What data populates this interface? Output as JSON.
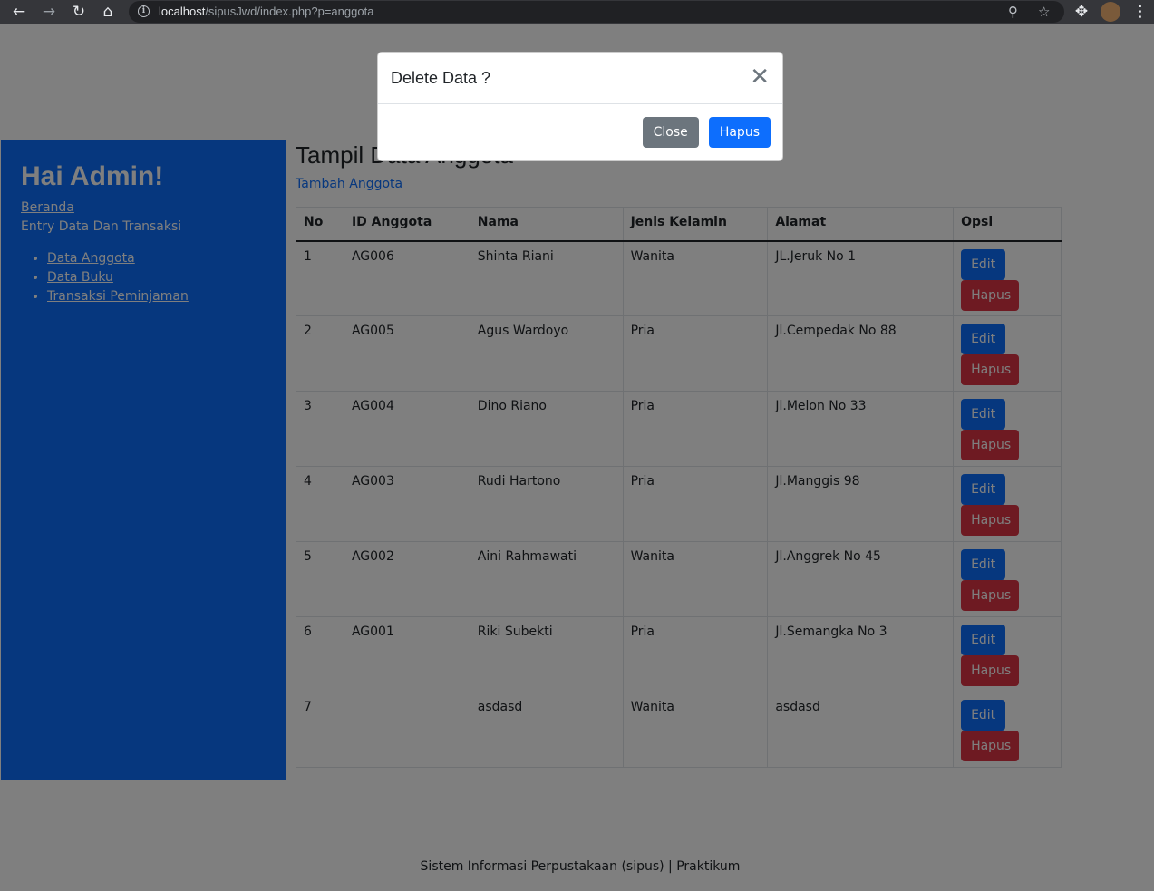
{
  "browser": {
    "url_host": "localhost",
    "url_path": "/sipusJwd/index.php?p=anggota"
  },
  "sidebar": {
    "title": "Hai Admin!",
    "home_link": "Beranda",
    "section_text": "Entry Data Dan Transaksi",
    "menu": [
      {
        "label": "Data Anggota"
      },
      {
        "label": "Data Buku"
      },
      {
        "label": "Transaksi Peminjaman"
      }
    ]
  },
  "main": {
    "title": "Tampil Data Anggota",
    "add_link": "Tambah Anggota",
    "columns": [
      "No",
      "ID Anggota",
      "Nama",
      "Jenis Kelamin",
      "Alamat",
      "Opsi"
    ],
    "rows": [
      {
        "no": "1",
        "id": "AG006",
        "nama": "Shinta Riani",
        "jk": "Wanita",
        "alamat": "JL.Jeruk No 1"
      },
      {
        "no": "2",
        "id": "AG005",
        "nama": "Agus Wardoyo",
        "jk": "Pria",
        "alamat": "Jl.Cempedak No 88"
      },
      {
        "no": "3",
        "id": "AG004",
        "nama": "Dino Riano",
        "jk": "Pria",
        "alamat": "Jl.Melon No 33"
      },
      {
        "no": "4",
        "id": "AG003",
        "nama": "Rudi Hartono",
        "jk": "Pria",
        "alamat": "Jl.Manggis 98"
      },
      {
        "no": "5",
        "id": "AG002",
        "nama": "Aini Rahmawati",
        "jk": "Wanita",
        "alamat": "Jl.Anggrek No 45"
      },
      {
        "no": "6",
        "id": "AG001",
        "nama": "Riki Subekti",
        "jk": "Pria",
        "alamat": "Jl.Semangka No 3"
      },
      {
        "no": "7",
        "id": "",
        "nama": "asdasd",
        "jk": "Wanita",
        "alamat": "asdasd"
      }
    ],
    "edit_label": "Edit",
    "delete_label": "Hapus"
  },
  "footer": {
    "text": "Sistem Informasi Perpustakaan (sipus) | Praktikum"
  },
  "modal": {
    "title": "Delete Data ?",
    "close_label": "Close",
    "confirm_label": "Hapus"
  },
  "colors": {
    "primary": "#0d6efd",
    "danger": "#dc3545",
    "secondary": "#6c757d"
  }
}
